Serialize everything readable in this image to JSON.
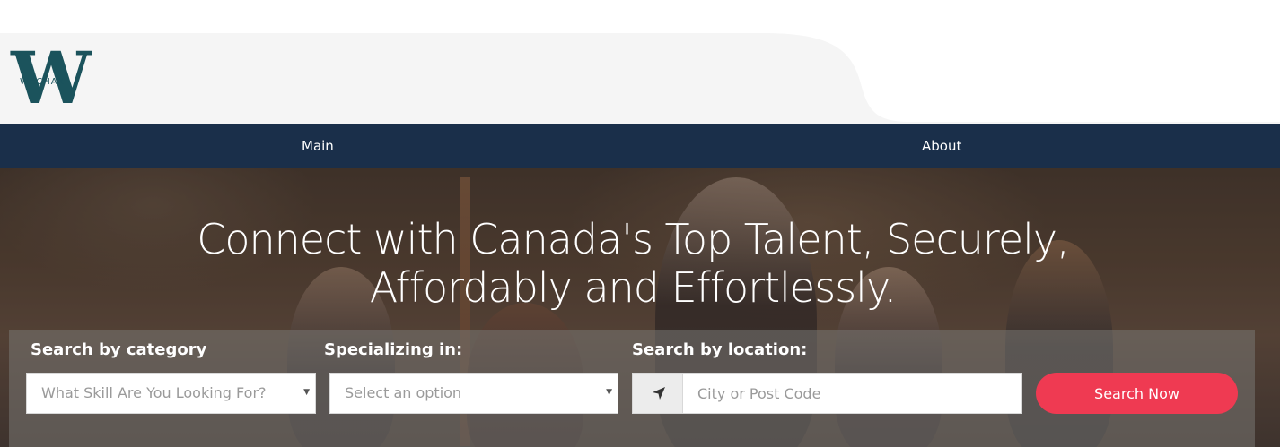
{
  "brand": {
    "logo_text": "WECHAX"
  },
  "nav": {
    "items": [
      {
        "label": "Main"
      },
      {
        "label": "About"
      }
    ]
  },
  "hero": {
    "headline_line1": "Connect with Canada's Top Talent, Securely,",
    "headline_line2": "Affordably and Effortlessly."
  },
  "search": {
    "category": {
      "label": "Search by category",
      "placeholder": "What Skill Are You Looking For?"
    },
    "specialization": {
      "label": "Specializing in:",
      "placeholder": "Select an option"
    },
    "location": {
      "label": "Search by location:",
      "placeholder": "City or Post Code",
      "icon": "location-arrow-icon"
    },
    "button_label": "Search Now"
  },
  "colors": {
    "nav_bg": "#1a2f4a",
    "accent": "#ef3a52",
    "logo": "#1b535c"
  }
}
